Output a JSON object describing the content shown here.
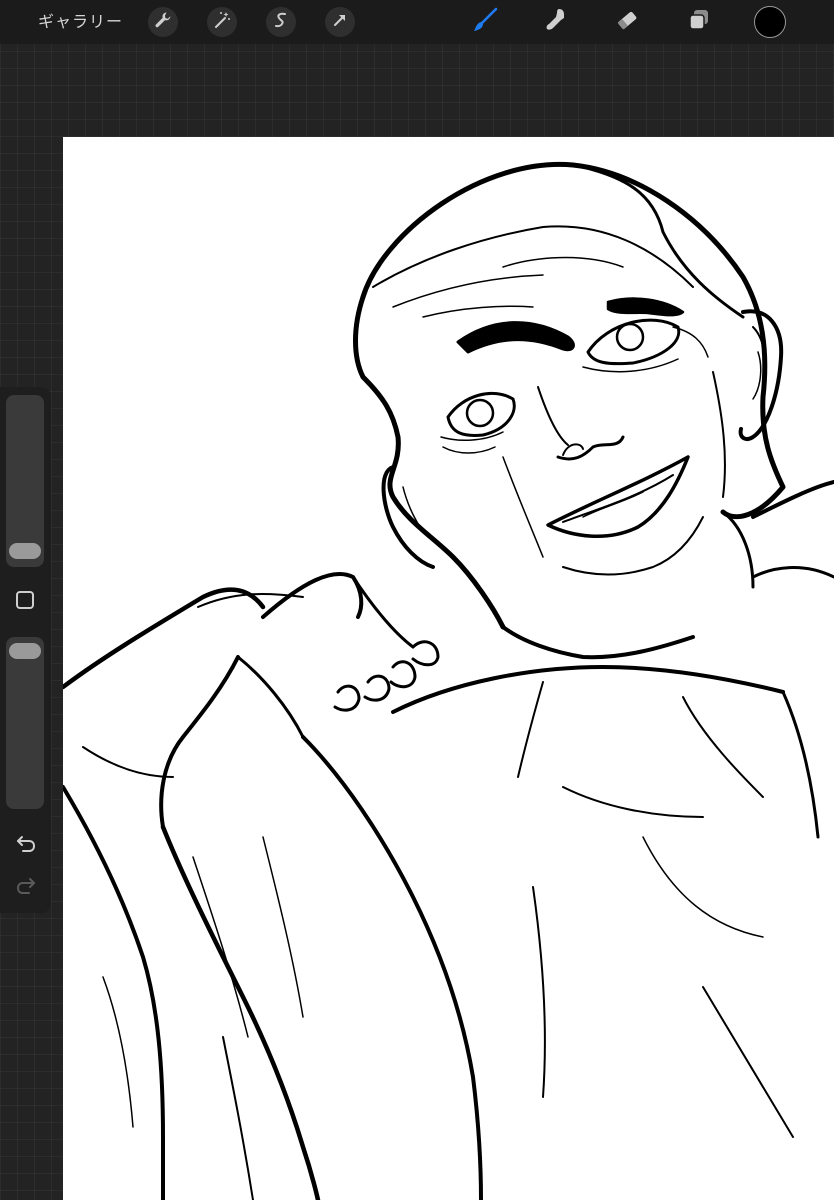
{
  "toolbar": {
    "gallery_label": "ギャラリー",
    "left_buttons": [
      "wrench-icon",
      "magic-wand-icon",
      "selection-icon",
      "transform-arrow-icon"
    ],
    "right_tools": [
      "brush-icon",
      "smudge-icon",
      "eraser-icon",
      "layers-icon"
    ],
    "active_tool": "brush-icon",
    "active_color": "#1e7bf0",
    "current_color": "#000000"
  },
  "sidebar": {
    "brush_size_level": 0.05,
    "opacity_level": 1.0,
    "buttons": [
      "modify-square-icon",
      "undo-icon",
      "redo-icon"
    ]
  },
  "canvas": {
    "background": "#ffffff",
    "content": "line-art-drawing"
  }
}
